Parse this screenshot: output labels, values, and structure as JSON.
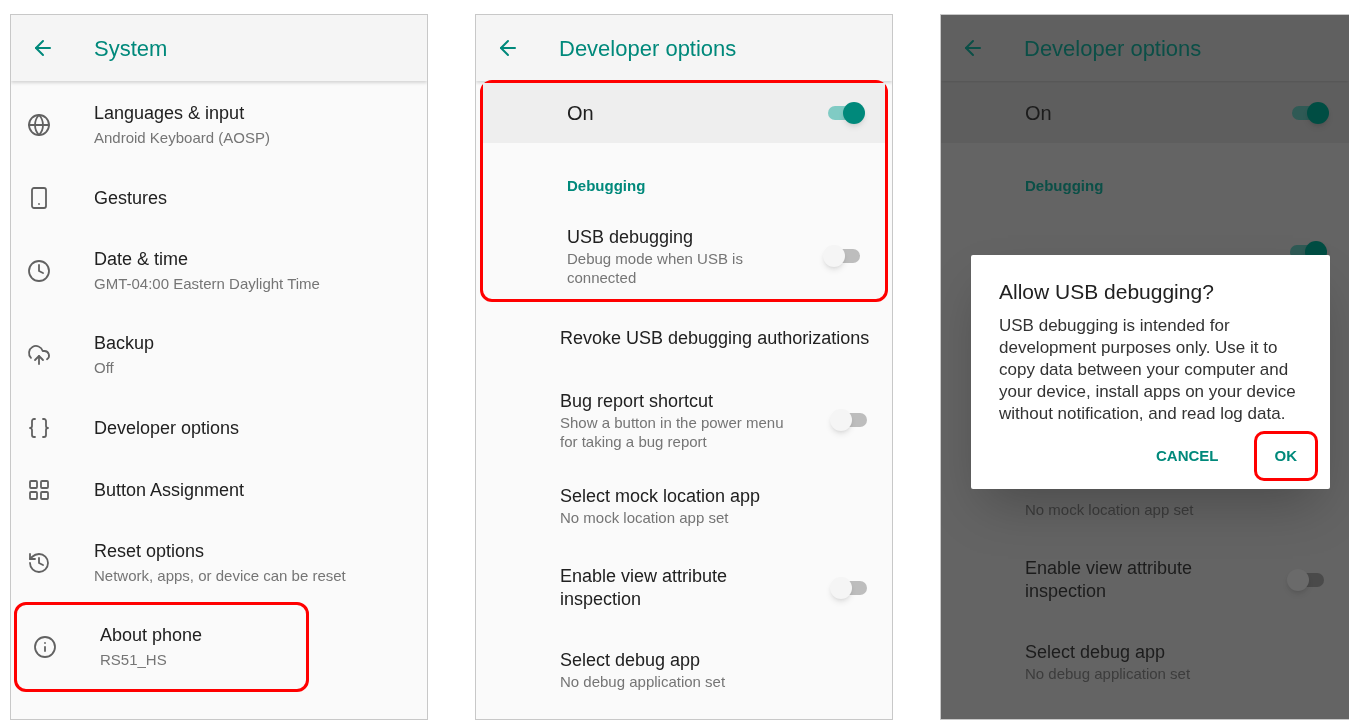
{
  "panels": [
    {
      "title": "System",
      "dimmed": false,
      "rows": [
        {
          "kind": "icon_item",
          "title": "Languages & input",
          "subtitle": "Android Keyboard (AOSP)",
          "highlighted": false
        },
        {
          "kind": "icon_item",
          "title": "Gestures",
          "highlighted": false
        },
        {
          "kind": "icon_item",
          "title": "Date & time",
          "subtitle": "GMT-04:00 Eastern Daylight Time",
          "highlighted": false
        },
        {
          "kind": "icon_item",
          "title": "Backup",
          "subtitle": "Off",
          "highlighted": false
        },
        {
          "kind": "icon_item",
          "title": "Developer options",
          "highlighted": false
        },
        {
          "kind": "icon_item",
          "title": "Button Assignment",
          "highlighted": false
        },
        {
          "kind": "icon_item",
          "title": "Reset options",
          "subtitle": "Network, apps, or device can be reset",
          "highlighted": false
        },
        {
          "kind": "icon_item",
          "title": "About phone",
          "subtitle": "RS51_HS",
          "highlighted": true
        }
      ]
    },
    {
      "title": "Developer options",
      "dimmed": false,
      "rows": [
        {
          "kind": "master_switch",
          "title": "On",
          "on": true,
          "highlighted": true
        },
        {
          "kind": "category",
          "title": "Debugging",
          "highlighted": true
        },
        {
          "kind": "item",
          "title": "USB debugging",
          "subtitle": "Debug mode when USB is connected",
          "on": false,
          "highlighted": true
        },
        {
          "kind": "item",
          "title": "Revoke USB debugging authorizations",
          "highlighted": false
        },
        {
          "kind": "item",
          "title": "Bug report shortcut",
          "subtitle": "Show a button in the power menu for taking a bug report",
          "on": false,
          "highlighted": false
        },
        {
          "kind": "item",
          "title": "Select mock location app",
          "subtitle": "No mock location app set",
          "highlighted": false
        },
        {
          "kind": "item",
          "title": "Enable view attribute inspection",
          "on": false,
          "highlighted": false
        },
        {
          "kind": "item",
          "title": "Select debug app",
          "subtitle": "No debug application set",
          "highlighted": false
        }
      ]
    },
    {
      "title": "Developer options",
      "dimmed": true,
      "rows": [
        {
          "kind": "master_switch",
          "title": "On",
          "on": true,
          "highlighted": false
        },
        {
          "kind": "category",
          "title": "Debugging",
          "highlighted": false
        },
        {
          "kind": "item",
          "on": true,
          "highlighted": false
        }
      ],
      "rows_below": [
        {
          "kind": "item",
          "subtitle": "No mock location app set",
          "highlighted": false
        },
        {
          "kind": "item",
          "title": "Enable view attribute inspection",
          "on": false,
          "highlighted": false
        },
        {
          "kind": "item",
          "title": "Select debug app",
          "subtitle": "No debug application set",
          "highlighted": false
        }
      ],
      "dialog": {
        "title": "Allow USB debugging?",
        "message": "USB debugging is intended for development purposes only. Use it to copy data between your computer and your device, install apps on your device without notification, and read log data.",
        "buttons": [
          {
            "label": "CANCEL",
            "highlighted": false
          },
          {
            "label": "OK",
            "highlighted": true
          }
        ]
      }
    }
  ]
}
